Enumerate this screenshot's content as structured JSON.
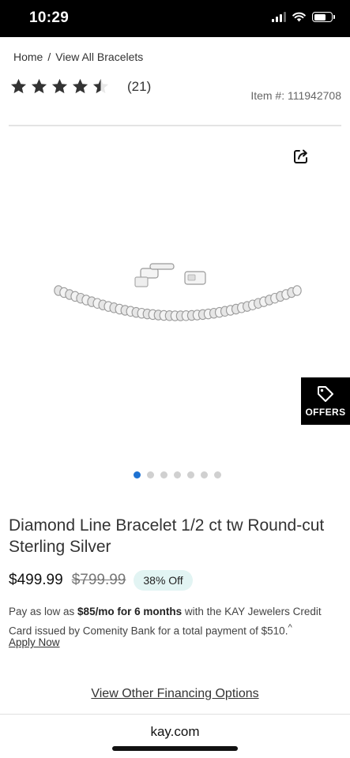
{
  "status_bar": {
    "time": "10:29",
    "battery_level": 0.7
  },
  "breadcrumb": {
    "home": "Home",
    "separator": "/",
    "current": "View All Bracelets"
  },
  "rating": {
    "stars": 4.5,
    "max_stars": 5,
    "review_count": "(21)"
  },
  "item_number": "Item #: 111942708",
  "icons": {
    "share": "share-icon",
    "offers": "tag-icon"
  },
  "offers_label": "OFFERS",
  "carousel": {
    "total": 7,
    "active": 0
  },
  "product": {
    "title": "Diamond Line Bracelet 1/2 ct tw Round-cut Sterling Silver",
    "price": "$499.99",
    "original_price": "$799.99",
    "discount": "38% Off"
  },
  "financing": {
    "pre": "Pay as low as ",
    "monthly": "$85/mo for 6 months",
    "post": " with the KAY Jewelers Credit Card issued by Comenity Bank for a total payment of $510.",
    "footnote": "^",
    "apply_label": "Apply Now",
    "view_options_label": "View Other Financing Options"
  },
  "browser": {
    "url": "kay.com"
  },
  "colors": {
    "accent_dot": "#1e72d2",
    "discount_bg": "#e2f4f3",
    "offers_bg": "#000000"
  }
}
